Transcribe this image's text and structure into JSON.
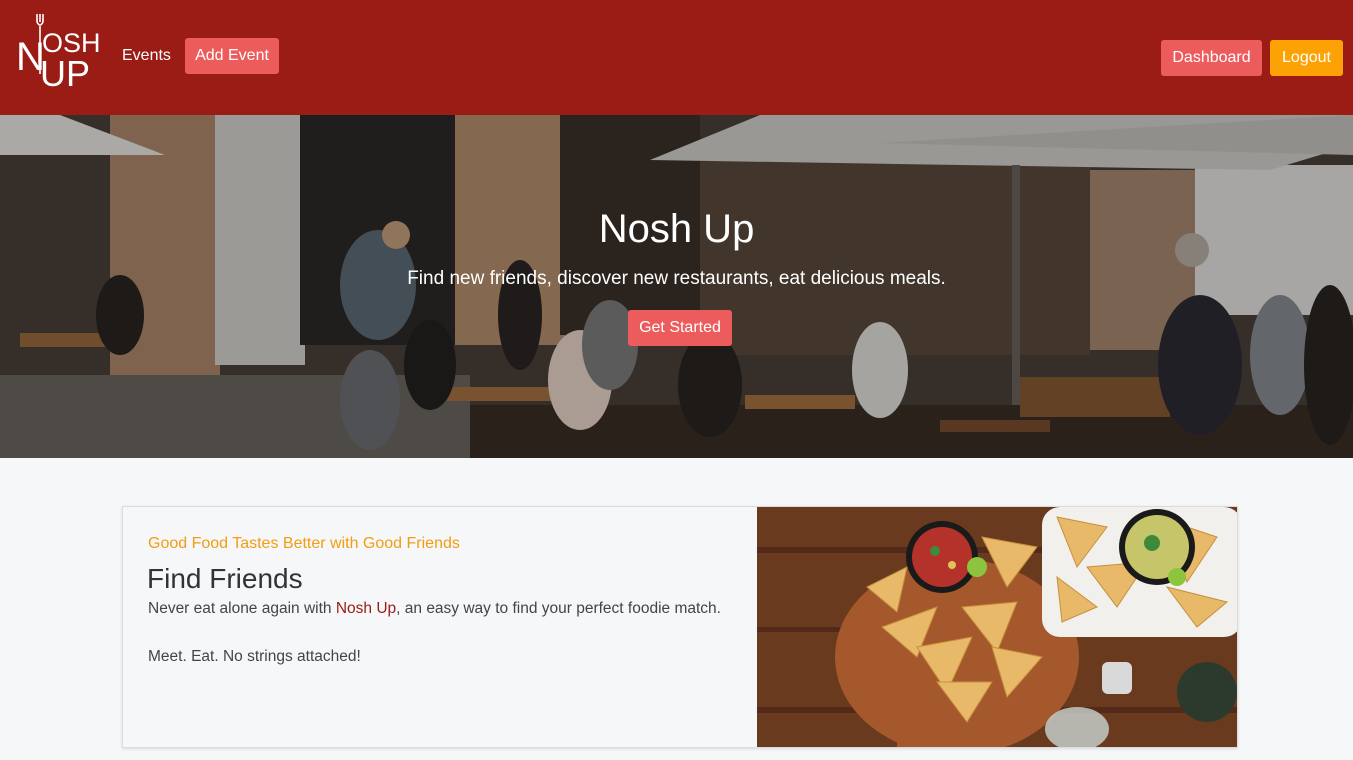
{
  "brand": {
    "logo_top": "OSH",
    "logo_bottom": "UP",
    "logo_letter": "N",
    "name": "Nosh Up"
  },
  "nav": {
    "events_label": "Events",
    "add_event_label": "Add Event",
    "dashboard_label": "Dashboard",
    "logout_label": "Logout"
  },
  "hero": {
    "title": "Nosh Up",
    "subtitle": "Find new friends, discover new restaurants, eat delicious meals.",
    "cta_label": "Get Started"
  },
  "feature": {
    "kicker": "Good Food Tastes Better with Good Friends",
    "title": "Find Friends",
    "text_before": "Never eat alone again with ",
    "text_brand": "Nosh Up",
    "text_after": ", an easy way to find your perfect foodie match.",
    "tagline": "Meet. Eat. No strings attached!"
  },
  "colors": {
    "navbar": "#9a1c14",
    "primary_button": "#ed5c5c",
    "logout_button": "#fca205",
    "accent_text": "#f39c12"
  },
  "icons": {
    "logo_fork": "fork-icon"
  }
}
